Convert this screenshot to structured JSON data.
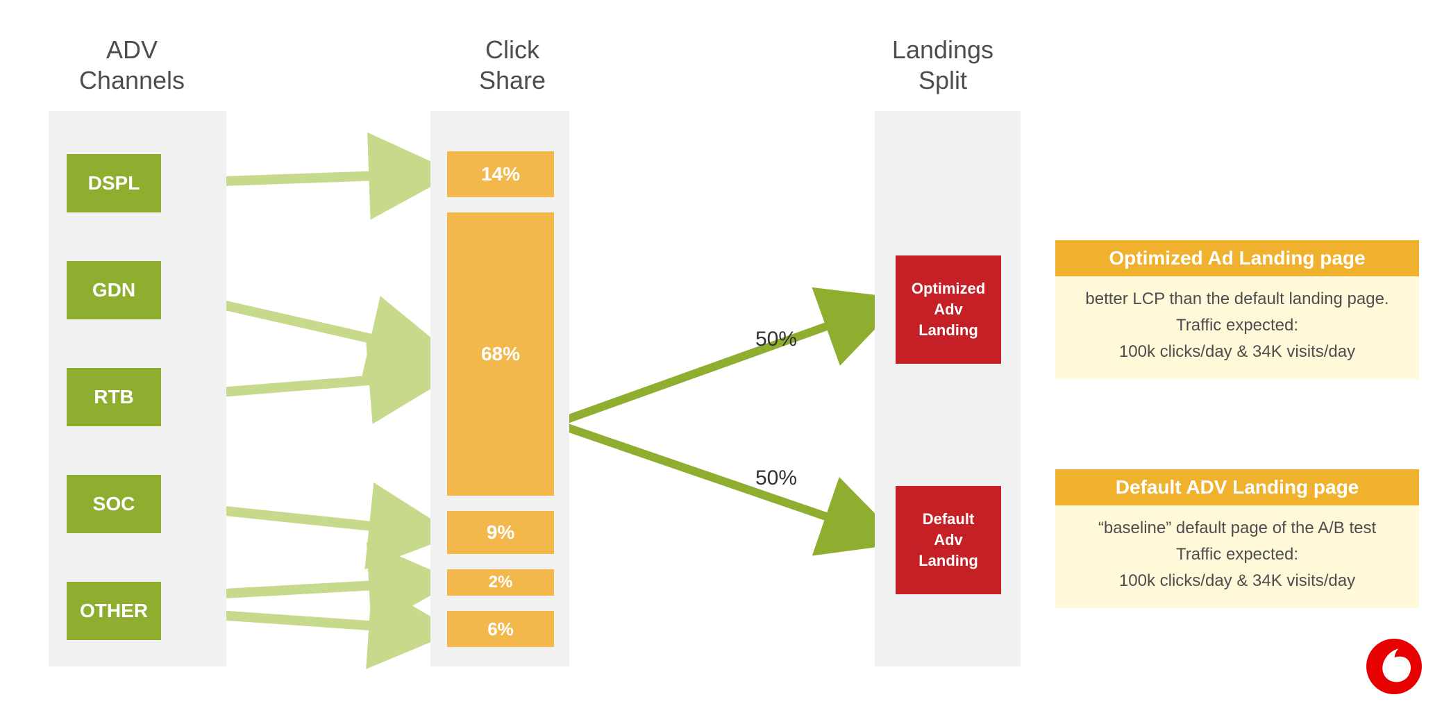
{
  "headers": {
    "channels": "ADV\nChannels",
    "clickshare": "Click\nShare",
    "landings": "Landings\nSplit"
  },
  "channels": [
    "DSPL",
    "GDN",
    "RTB",
    "SOC",
    "OTHER"
  ],
  "click_share": {
    "dspl": "14%",
    "main": "68%",
    "soc": "9%",
    "two": "2%",
    "other": "6%"
  },
  "split": {
    "top_pct": "50%",
    "bot_pct": "50%"
  },
  "landings": {
    "optimized": "Optimized\nAdv\nLanding",
    "default": "Default\nAdv\nLanding"
  },
  "cards": {
    "optimized": {
      "title": "Optimized Ad Landing page",
      "line1": "better LCP than the default landing page.",
      "line2": "Traffic expected:",
      "line3": "100k clicks/day  & 34K visits/day"
    },
    "default": {
      "title": "Default ADV Landing page",
      "line1": "“baseline” default page of the A/B test",
      "line2": "Traffic expected:",
      "line3": "100k clicks/day  & 34K visits/day"
    }
  },
  "chart_data": {
    "type": "bar",
    "title": "ADV Channels → Click Share → Landings Split",
    "click_share": {
      "categories": [
        "DSPL",
        "GDN+RTB (main)",
        "SOC",
        "2% slice",
        "OTHER"
      ],
      "values_pct": [
        14,
        68,
        9,
        2,
        6
      ]
    },
    "landings_split": {
      "categories": [
        "Optimized Adv Landing",
        "Default Adv Landing"
      ],
      "values_pct": [
        50,
        50
      ]
    }
  }
}
